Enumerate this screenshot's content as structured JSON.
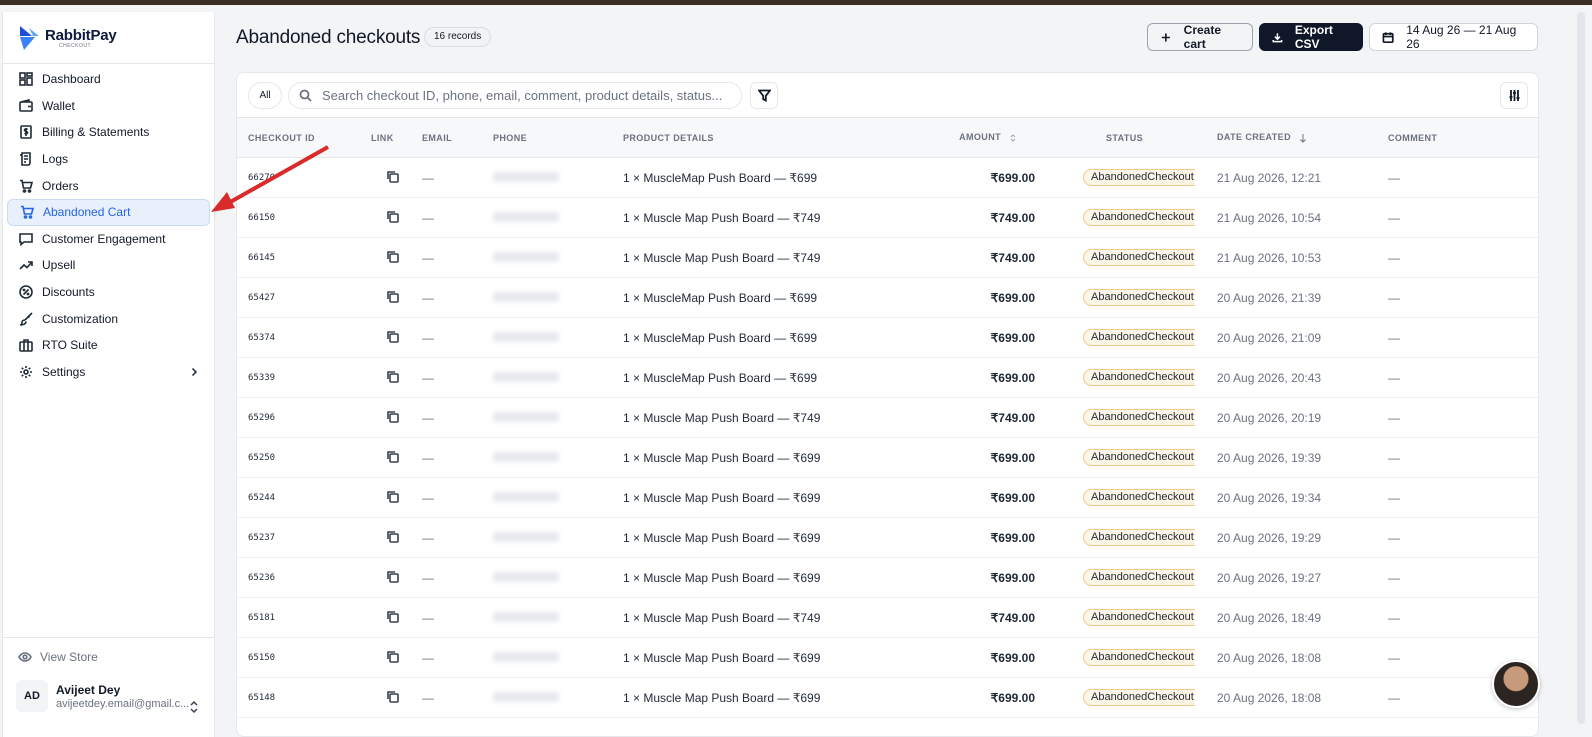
{
  "brand": {
    "name": "RabbitPay",
    "sub": "CHECKOUT"
  },
  "sidebar": {
    "items": [
      {
        "label": "Dashboard",
        "icon": "dashboard-icon"
      },
      {
        "label": "Wallet",
        "icon": "wallet-icon"
      },
      {
        "label": "Billing & Statements",
        "icon": "billing-icon"
      },
      {
        "label": "Logs",
        "icon": "logs-icon"
      },
      {
        "label": "Orders",
        "icon": "cart-icon"
      },
      {
        "label": "Abandoned Cart",
        "icon": "cart-icon"
      },
      {
        "label": "Customer Engagement",
        "icon": "chat-icon"
      },
      {
        "label": "Upsell",
        "icon": "trend-up-icon"
      },
      {
        "label": "Discounts",
        "icon": "discount-icon"
      },
      {
        "label": "Customization",
        "icon": "brush-icon"
      },
      {
        "label": "RTO Suite",
        "icon": "briefcase-icon"
      },
      {
        "label": "Settings",
        "icon": "gear-icon"
      }
    ],
    "view_store": "View Store",
    "user": {
      "initials": "AD",
      "name": "Avijeet Dey",
      "email": "avijeetdey.email@gmail.c..."
    }
  },
  "header": {
    "title": "Abandoned checkouts",
    "records": "16 records",
    "create_cart": "Create cart",
    "export_csv": "Export CSV",
    "date_range": "14 Aug 26 — 21 Aug 26"
  },
  "toolbar": {
    "all": "All",
    "search_placeholder": "Search checkout ID, phone, email, comment, product details, status..."
  },
  "table": {
    "columns": [
      "CHECKOUT ID",
      "LINK",
      "EMAIL",
      "PHONE",
      "PRODUCT DETAILS",
      "AMOUNT",
      "STATUS",
      "DATE CREATED",
      "COMMENT"
    ],
    "rows": [
      {
        "id": "66270",
        "email": "—",
        "product": "1 × MuscleMap Push Board — ₹699",
        "amount": "₹699.00",
        "status": "AbandonedCheckout",
        "date": "21 Aug 2026, 12:21",
        "comment": "—"
      },
      {
        "id": "66150",
        "email": "—",
        "product": "1 × Muscle Map Push Board — ₹749",
        "amount": "₹749.00",
        "status": "AbandonedCheckout",
        "date": "21 Aug 2026, 10:54",
        "comment": "—"
      },
      {
        "id": "66145",
        "email": "—",
        "product": "1 × Muscle Map Push Board — ₹749",
        "amount": "₹749.00",
        "status": "AbandonedCheckout",
        "date": "21 Aug 2026, 10:53",
        "comment": "—"
      },
      {
        "id": "65427",
        "email": "—",
        "product": "1 × MuscleMap Push Board — ₹699",
        "amount": "₹699.00",
        "status": "AbandonedCheckout",
        "date": "20 Aug 2026, 21:39",
        "comment": "—"
      },
      {
        "id": "65374",
        "email": "—",
        "product": "1 × MuscleMap Push Board — ₹699",
        "amount": "₹699.00",
        "status": "AbandonedCheckout",
        "date": "20 Aug 2026, 21:09",
        "comment": "—"
      },
      {
        "id": "65339",
        "email": "—",
        "product": "1 × MuscleMap Push Board — ₹699",
        "amount": "₹699.00",
        "status": "AbandonedCheckout",
        "date": "20 Aug 2026, 20:43",
        "comment": "—"
      },
      {
        "id": "65296",
        "email": "—",
        "product": "1 × Muscle Map Push Board — ₹749",
        "amount": "₹749.00",
        "status": "AbandonedCheckout",
        "date": "20 Aug 2026, 20:19",
        "comment": "—"
      },
      {
        "id": "65250",
        "email": "—",
        "product": "1 × Muscle Map Push Board — ₹699",
        "amount": "₹699.00",
        "status": "AbandonedCheckout",
        "date": "20 Aug 2026, 19:39",
        "comment": "—"
      },
      {
        "id": "65244",
        "email": "—",
        "product": "1 × Muscle Map Push Board — ₹699",
        "amount": "₹699.00",
        "status": "AbandonedCheckout",
        "date": "20 Aug 2026, 19:34",
        "comment": "—"
      },
      {
        "id": "65237",
        "email": "—",
        "product": "1 × Muscle Map Push Board — ₹699",
        "amount": "₹699.00",
        "status": "AbandonedCheckout",
        "date": "20 Aug 2026, 19:29",
        "comment": "—"
      },
      {
        "id": "65236",
        "email": "—",
        "product": "1 × Muscle Map Push Board — ₹699",
        "amount": "₹699.00",
        "status": "AbandonedCheckout",
        "date": "20 Aug 2026, 19:27",
        "comment": "—"
      },
      {
        "id": "65181",
        "email": "—",
        "product": "1 × Muscle Map Push Board — ₹749",
        "amount": "₹749.00",
        "status": "AbandonedCheckout",
        "date": "20 Aug 2026, 18:49",
        "comment": "—"
      },
      {
        "id": "65150",
        "email": "—",
        "product": "1 × Muscle Map Push Board — ₹699",
        "amount": "₹699.00",
        "status": "AbandonedCheckout",
        "date": "20 Aug 2026, 18:08",
        "comment": "—"
      },
      {
        "id": "65148",
        "email": "—",
        "product": "1 × Muscle Map Push Board — ₹699",
        "amount": "₹699.00",
        "status": "AbandonedCheckout",
        "date": "20 Aug 2026, 18:08",
        "comment": "—"
      }
    ]
  },
  "colors": {
    "accent": "#2563eb",
    "badge_bg": "#fdf5e6",
    "badge_border": "#f0c98a",
    "annotation_arrow": "#d92b2b",
    "primary_button": "#0f1729"
  }
}
